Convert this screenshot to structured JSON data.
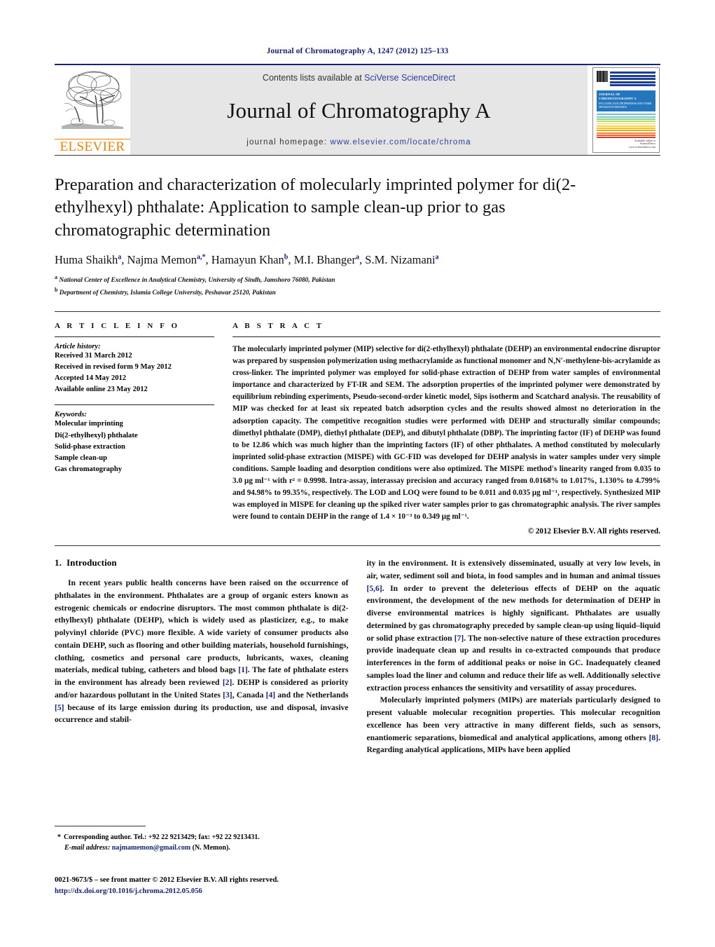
{
  "running_head": "Journal of Chromatography A, 1247 (2012) 125–133",
  "masthead": {
    "publisher_name": "ELSEVIER",
    "contents_prefix": "Contents lists available at ",
    "contents_link": "SciVerse ScienceDirect",
    "journal_title": "Journal of Chromatography A",
    "homepage_prefix": "journal homepage: ",
    "homepage_url": "www.elsevier.com/locate/chroma",
    "cover": {
      "banner_title": "JOURNAL OF CHROMATOGRAPHY A",
      "banner_subtitle": "INCLUDING ELECTROPHORESIS AND OTHER SEPARATION METHODS",
      "footer_logo": "ScienceDirect",
      "footer_logo_sub": "www.sciencedirect.com",
      "footer_available": "Available online at"
    }
  },
  "article": {
    "title": "Preparation and characterization of molecularly imprinted polymer for di(2-ethylhexyl) phthalate: Application to sample clean-up prior to gas chromatographic determination",
    "authors": "Huma Shaikh|a|, Najma Memon|a,*|, Hamayun Khan|b|, M.I. Bhanger|a|, S.M. Nizamani|a|",
    "affiliation_a": "National Center of Excellence in Analytical Chemistry, University of Sindh, Jamshoro 76080, Pakistan",
    "affiliation_a_mark": "a",
    "affiliation_b": "Department of Chemistry, Islamia College University, Peshawar 25120, Pakistan",
    "affiliation_b_mark": "b"
  },
  "article_info": {
    "heading": "A R T I C L E   I N F O",
    "history_label": "Article history:",
    "history": [
      "Received 31 March 2012",
      "Received in revised form 9 May 2012",
      "Accepted 14 May 2012",
      "Available online 23 May 2012"
    ],
    "keywords_label": "Keywords:",
    "keywords": [
      "Molecular imprinting",
      "Di(2-ethylhexyl) phthalate",
      "Solid-phase extraction",
      "Sample clean-up",
      "Gas chromatography"
    ]
  },
  "abstract": {
    "heading": "A B S T R A C T",
    "text": "The molecularly imprinted polymer (MIP) selective for di(2-ethylhexyl) phthalate (DEHP) an environmental endocrine disruptor was prepared by suspension polymerization using methacrylamide as functional monomer and N,N′-methylene-bis-acrylamide as cross-linker. The imprinted polymer was employed for solid-phase extraction of DEHP from water samples of environmental importance and characterized by FT-IR and SEM. The adsorption properties of the imprinted polymer were demonstrated by equilibrium rebinding experiments, Pseudo-second-order kinetic model, Sips isotherm and Scatchard analysis. The reusability of MIP was checked for at least six repeated batch adsorption cycles and the results showed almost no deterioration in the adsorption capacity. The competitive recognition studies were performed with DEHP and structurally similar compounds; dimethyl phthalate (DMP), diethyl phthalate (DEP), and dibutyl phthalate (DBP). The imprinting factor (IF) of DEHP was found to be 12.86 which was much higher than the imprinting factors (IF) of other phthalates. A method constituted by molecularly imprinted solid-phase extraction (MISPE) with GC-FID was developed for DEHP analysis in water samples under very simple conditions. Sample loading and desorption conditions were also optimized. The MISPE method's linearity ranged from 0.035 to 3.0 μg ml⁻¹ with r² = 0.9998. Intra-assay, interassay precision and accuracy ranged from 0.0168% to 1.017%, 1.130% to 4.799% and 94.98% to 99.35%, respectively. The LOD and LOQ were found to be 0.011 and 0.035 μg ml⁻¹, respectively. Synthesized MIP was employed in MISPE for cleaning up the spiked river water samples prior to gas chromatographic analysis. The river samples were found to contain DEHP in the range of 1.4 × 10⁻³ to 0.349 μg ml⁻¹.",
    "copyright": "© 2012 Elsevier B.V. All rights reserved."
  },
  "introduction": {
    "number": "1.",
    "heading": "Introduction",
    "left_paragraph": "In recent years public health concerns have been raised on the occurrence of phthalates in the environment. Phthalates are a group of organic esters known as estrogenic chemicals or endocrine disruptors. The most common phthalate is di(2-ethylhexyl) phthalate (DEHP), which is widely used as plasticizer, e.g., to make polyvinyl chloride (PVC) more flexible. A wide variety of consumer products also contain DEHP, such as flooring and other building materials, household furnishings, clothing, cosmetics and personal care products, lubricants, waxes, cleaning materials, medical tubing, catheters and blood bags [1]. The fate of phthalate esters in the environment has already been reviewed [2]. DEHP is considered as priority and/or hazardous pollutant in the United States [3], Canada [4] and the Netherlands [5] because of its large emission during its production, use and disposal, invasive occurrence and stabil-",
    "right_paragraph_1": "ity in the environment. It is extensively disseminated, usually at very low levels, in air, water, sediment soil and biota, in food samples and in human and animal tissues [5,6]. In order to prevent the deleterious effects of DEHP on the aquatic environment, the development of the new methods for determination of DEHP in diverse environmental matrices is highly significant. Phthalates are usually determined by gas chromatography preceded by sample clean-up using liquid–liquid or solid phase extraction [7]. The non-selective nature of these extraction procedures provide inadequate clean up and results in co-extracted compounds that produce interferences in the form of additional peaks or noise in GC. Inadequately cleaned samples load the liner and column and reduce their life as well. Additionally selective extraction process enhances the sensitivity and versatility of assay procedures.",
    "right_paragraph_2": "Molecularly imprinted polymers (MIPs) are materials particularly designed to present valuable molecular recognition properties. This molecular recognition excellence has been very attractive in many different fields, such as sensors, enantiomeric separations, biomedical and analytical applications, among others [8]. Regarding analytical applications, MIPs have been applied"
  },
  "footnote": {
    "star": "*",
    "corresponding": "Corresponding author. Tel.: +92 22 9213429; fax: +92 22 9213431.",
    "email_label": "E-mail address:",
    "email": "najmamemon@gmail.com",
    "email_owner": "(N. Memon)."
  },
  "issn": {
    "line": "0021-9673/$ – see front matter © 2012 Elsevier B.V. All rights reserved.",
    "doi": "http://dx.doi.org/10.1016/j.chroma.2012.05.056"
  },
  "colors": {
    "link_blue": "#2b3f9e",
    "ref_blue": "#14227a",
    "elsevier_orange": "#ef8200",
    "band_gray": "#e6e6e6"
  }
}
